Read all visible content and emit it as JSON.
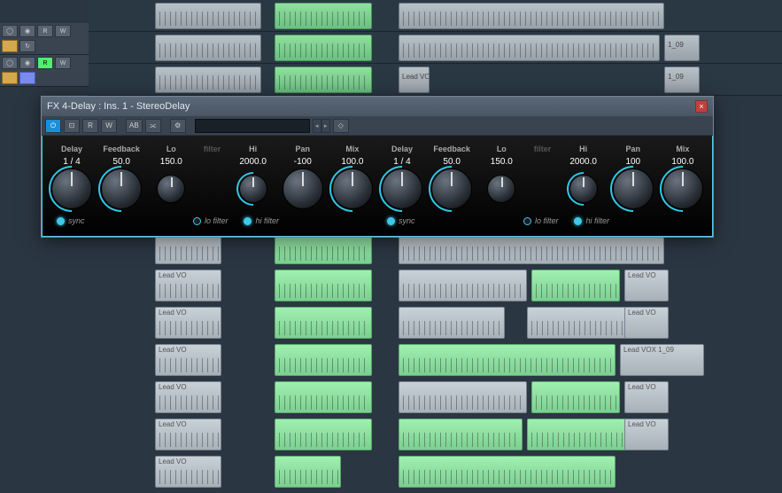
{
  "window": {
    "title": "FX 4-Delay : Ins. 1 - StereoDelay"
  },
  "toolbar": {
    "power": "⏻",
    "bypass": "⊡",
    "r": "R",
    "w": "W",
    "ab": "AB",
    "link": "⫘",
    "settings": "⚙"
  },
  "params": {
    "delay_label": "Delay",
    "feedback_label": "Feedback",
    "lo_label": "Lo",
    "filter_label": "filter",
    "hi_label": "Hi",
    "pan_label": "Pan",
    "mix_label": "Mix"
  },
  "left": {
    "delay": "1 / 4",
    "feedback": "50.0",
    "lo": "150.0",
    "hi": "2000.0",
    "pan": "-100",
    "mix": "100.0"
  },
  "right": {
    "delay": "1 / 4",
    "feedback": "50.0",
    "lo": "150.0",
    "hi": "2000.0",
    "pan": "100",
    "mix": "100.0"
  },
  "toggles": {
    "sync": "sync",
    "lo_filter": "lo filter",
    "hi_filter": "hi filter"
  },
  "track_buttons": {
    "r": "R",
    "w": "W"
  },
  "clips": {
    "lead_vox_short": "Lead VO",
    "lead_vox_109": "1_09",
    "lead_vox_full": "Lead VOX 1_09"
  }
}
